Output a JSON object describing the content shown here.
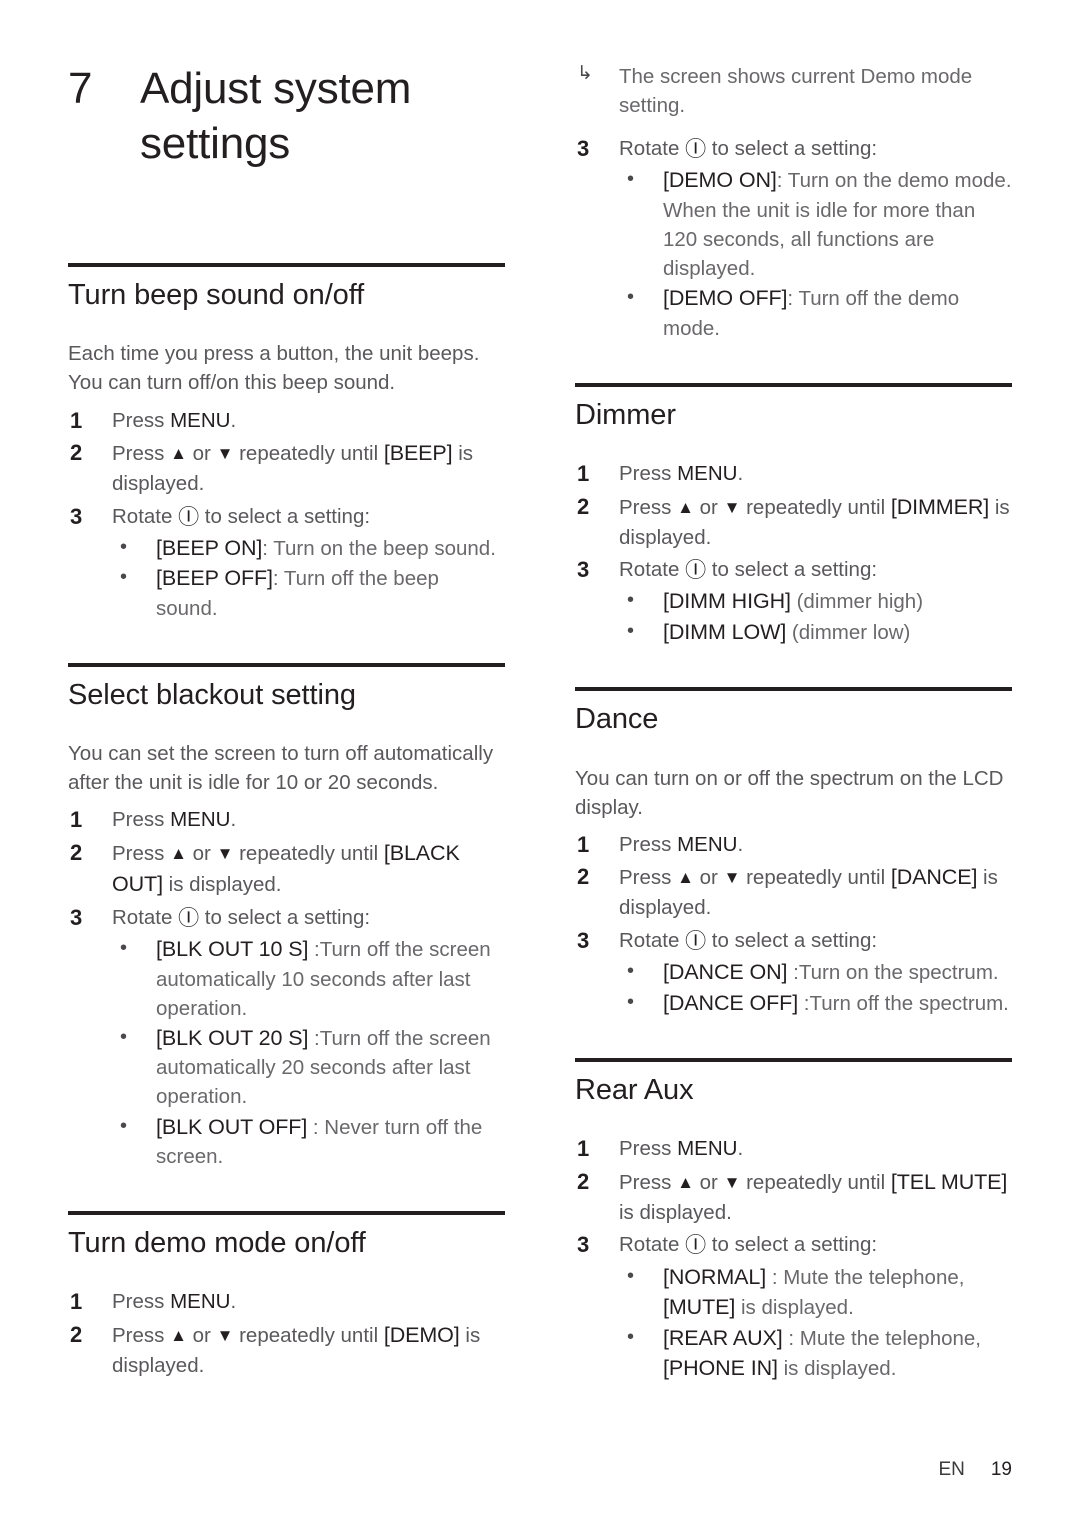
{
  "chapter": {
    "number": "7",
    "title": "Adjust system settings"
  },
  "glyphs": {
    "up": "▲",
    "down": "▼",
    "power": "Ⓘ",
    "bullet": "•",
    "result_arrow": "↳"
  },
  "left_column": {
    "sections": [
      {
        "heading": "Turn beep sound on/off",
        "intro": "Each time you press a button, the unit beeps. You can turn off/on this beep sound.",
        "steps": [
          {
            "num": "1",
            "pre": "Press ",
            "kbd": "MENU",
            "post": "."
          },
          {
            "num": "2",
            "pre": "Press ",
            "mid": " or ",
            "post": " repeatedly until ",
            "token": "[BEEP]",
            "tail": " is displayed."
          },
          {
            "num": "3",
            "pre": "Rotate ",
            "post": " to select a setting:"
          }
        ],
        "options": [
          {
            "token": "[BEEP ON]",
            "desc": ": Turn on the beep sound."
          },
          {
            "token": "[BEEP OFF]",
            "desc": ": Turn off the beep sound."
          }
        ]
      },
      {
        "heading": "Select blackout setting",
        "intro": "You can set the screen to turn off automatically after the unit is idle for 10 or 20 seconds.",
        "steps": [
          {
            "num": "1",
            "pre": "Press ",
            "kbd": "MENU",
            "post": "."
          },
          {
            "num": "2",
            "pre": "Press ",
            "mid": " or ",
            "post": " repeatedly until ",
            "token": "[BLACK OUT]",
            "tail": " is displayed."
          },
          {
            "num": "3",
            "pre": "Rotate ",
            "post": " to select a setting:"
          }
        ],
        "options": [
          {
            "token": "[BLK OUT 10 S]",
            "desc": " :Turn off the screen automatically 10 seconds after last operation."
          },
          {
            "token": "[BLK OUT 20 S]",
            "desc": " :Turn off the screen automatically 20 seconds after last operation."
          },
          {
            "token": "[BLK OUT OFF]",
            "desc": " : Never turn off the screen."
          }
        ]
      },
      {
        "heading": "Turn demo mode on/off",
        "intro": "",
        "steps": [
          {
            "num": "1",
            "pre": "Press ",
            "kbd": "MENU",
            "post": "."
          },
          {
            "num": "2",
            "pre": "Press ",
            "mid": " or ",
            "post": " repeatedly until ",
            "token": "[DEMO]",
            "tail": " is displayed."
          }
        ],
        "options": []
      }
    ]
  },
  "right_column": {
    "continued_note": "The screen shows current Demo mode setting.",
    "continued_step": {
      "num": "3",
      "pre": "Rotate ",
      "post": " to select a setting:"
    },
    "continued_options": [
      {
        "token": "[DEMO ON]",
        "desc": ": Turn on the demo mode. When the unit is idle for more than 120 seconds, all functions are displayed."
      },
      {
        "token": "[DEMO OFF]",
        "desc": ": Turn off the demo mode."
      }
    ],
    "sections": [
      {
        "heading": "Dimmer",
        "intro": "",
        "steps": [
          {
            "num": "1",
            "pre": "Press ",
            "kbd": "MENU",
            "post": "."
          },
          {
            "num": "2",
            "pre": "Press ",
            "mid": " or ",
            "post": " repeatedly until ",
            "token": "[DIMMER]",
            "tail": " is displayed."
          },
          {
            "num": "3",
            "pre": "Rotate ",
            "post": " to select a setting:"
          }
        ],
        "options": [
          {
            "token": "[DIMM HIGH]",
            "desc": " (dimmer high)"
          },
          {
            "token": "[DIMM LOW]",
            "desc": " (dimmer low)"
          }
        ]
      },
      {
        "heading": "Dance",
        "intro": "You can turn on or off the spectrum on the LCD display.",
        "steps": [
          {
            "num": "1",
            "pre": "Press ",
            "kbd": "MENU",
            "post": "."
          },
          {
            "num": "2",
            "pre": "Press ",
            "mid": " or ",
            "post": " repeatedly until ",
            "token": "[DANCE]",
            "tail": " is displayed."
          },
          {
            "num": "3",
            "pre": "Rotate ",
            "post": " to select a setting:"
          }
        ],
        "options": [
          {
            "token": "[DANCE ON]",
            "desc": " :Turn on the spectrum."
          },
          {
            "token": "[DANCE OFF]",
            "desc": " :Turn off the spectrum."
          }
        ]
      },
      {
        "heading": "Rear Aux",
        "intro": "",
        "steps": [
          {
            "num": "1",
            "pre": "Press ",
            "kbd": "MENU",
            "post": "."
          },
          {
            "num": "2",
            "pre": "Press ",
            "mid": " or ",
            "post": " repeatedly until ",
            "token": "[TEL MUTE]",
            "tail": " is displayed."
          },
          {
            "num": "3",
            "pre": "Rotate ",
            "post": " to select a setting:"
          }
        ],
        "options": [
          {
            "token": "[NORMAL]",
            "desc": " : Mute the telephone, ",
            "token2": "[MUTE]",
            "desc2": " is displayed."
          },
          {
            "token": "[REAR AUX]",
            "desc": " : Mute the telephone, ",
            "token2": "[PHONE IN]",
            "desc2": " is displayed."
          }
        ]
      }
    ]
  },
  "footer": {
    "language": "EN",
    "page_number": "19"
  }
}
